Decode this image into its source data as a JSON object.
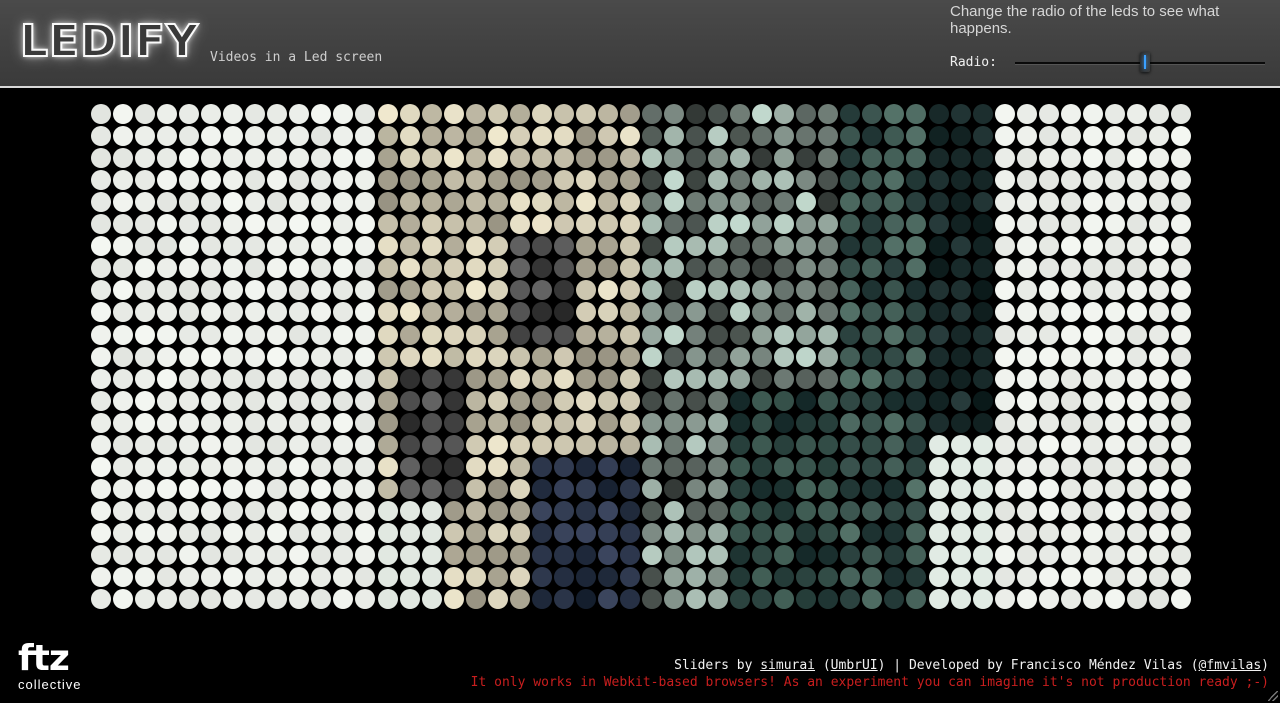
{
  "header": {
    "logo": "LEDIFY",
    "tagline": "Videos in a Led screen",
    "help_text": "Change the radio of the leds to see what happens.",
    "radio_label": "Radio:",
    "radio_value_fraction": 0.52,
    "accent_color": "#3aa0ff"
  },
  "led_screen": {
    "columns": 50,
    "rows": 23,
    "bright_color": "#e8eee8",
    "dark_color": "#0d1515"
  },
  "footer": {
    "brand_mark": "ftz",
    "brand_sub": "collective",
    "credit_prefix": "Sliders by ",
    "credit_author_link": "simurai",
    "credit_paren_open": " (",
    "credit_lib_link": "UmbrUI",
    "credit_mid": ") | Developed by Francisco Méndez Vilas (",
    "credit_twitter_link": "@fmvilas",
    "credit_paren_close": ")",
    "warning": "It only works in Webkit-based browsers! As an experiment you can imagine it's not production ready ;-)",
    "warning_color": "#c81e1e"
  }
}
